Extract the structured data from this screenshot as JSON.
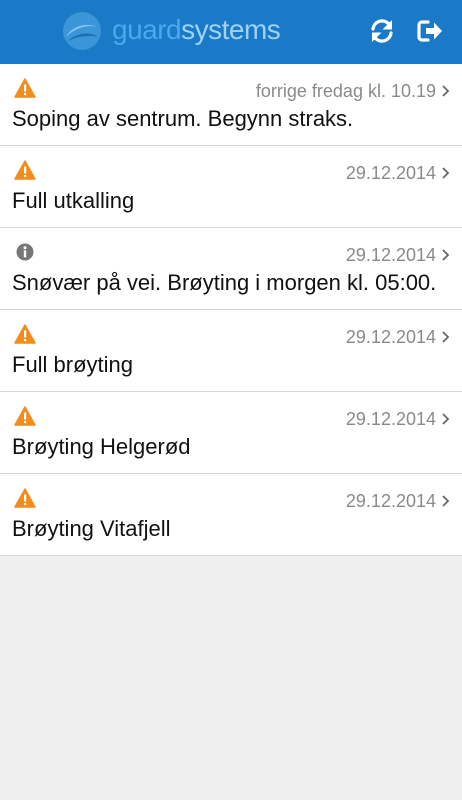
{
  "app": {
    "brand_part1": "guard",
    "brand_part2": "systems",
    "colors": {
      "header": "#1a7ac7",
      "warning": "#f28c1b",
      "info": "#777777"
    },
    "actions": {
      "refresh_icon": "refresh-icon",
      "logout_icon": "logout-icon"
    }
  },
  "messages": [
    {
      "icon": "warning-icon",
      "date": "forrige fredag kl. 10.19",
      "title": "Soping av sentrum. Begynn straks."
    },
    {
      "icon": "warning-icon",
      "date": "29.12.2014",
      "title": "Full utkalling"
    },
    {
      "icon": "info-icon",
      "date": "29.12.2014",
      "title": "Snøvær på vei. Brøyting i morgen kl. 05:00."
    },
    {
      "icon": "warning-icon",
      "date": "29.12.2014",
      "title": "Full brøyting"
    },
    {
      "icon": "warning-icon",
      "date": "29.12.2014",
      "title": "Brøyting Helgerød"
    },
    {
      "icon": "warning-icon",
      "date": "29.12.2014",
      "title": "Brøyting Vitafjell"
    }
  ]
}
